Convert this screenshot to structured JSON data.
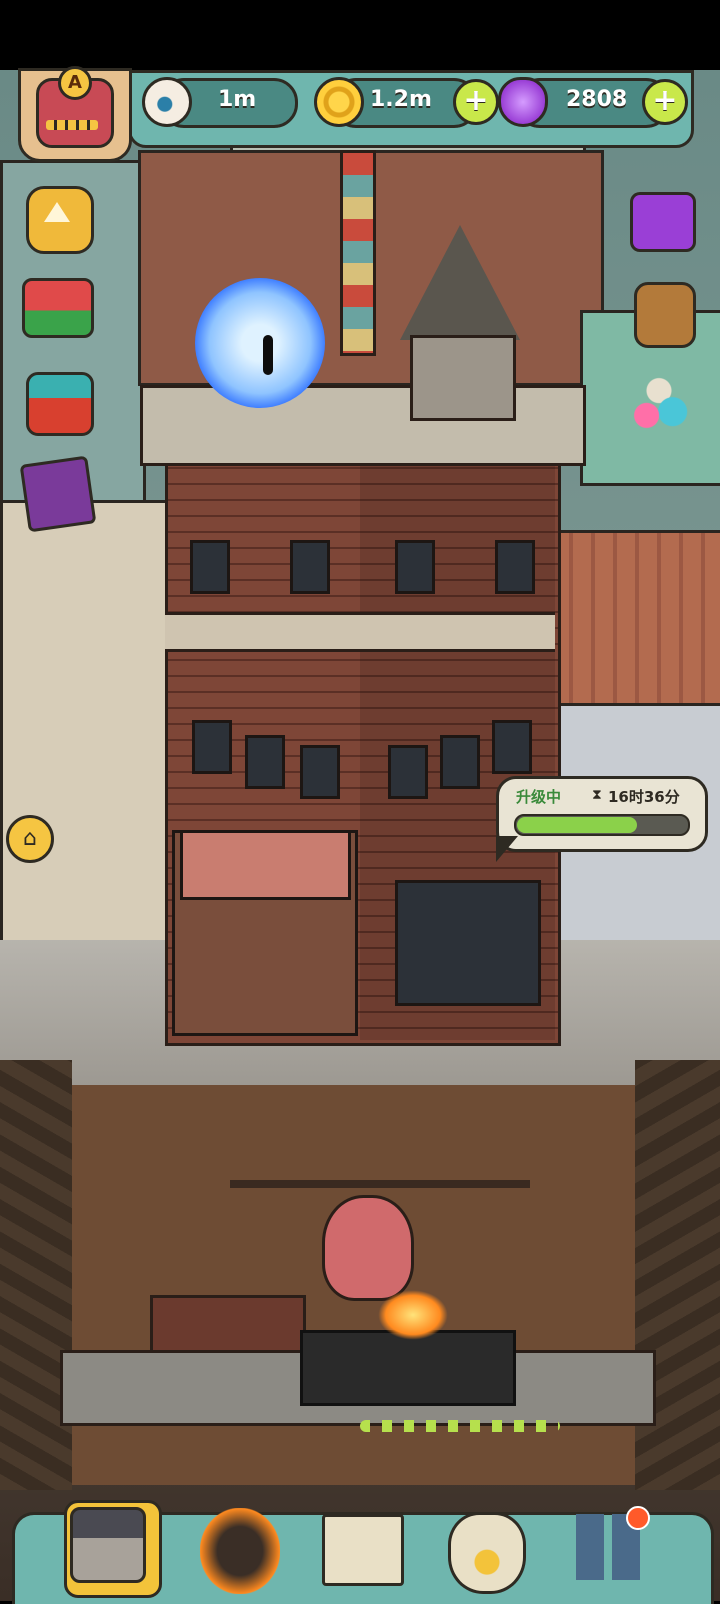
{
  "hud": {
    "level_letter": "A",
    "eyes_value": "1m",
    "coins_value": "1.2m",
    "potions_value": "2808",
    "plus_symbol": "+",
    "colors": {
      "bar": "#6fb6ae",
      "plus": "#c9e84a",
      "coin": "#ffd54a",
      "potion": "#9a3fd6"
    }
  },
  "left_buttons": [
    "up-arrow-icon",
    "gift-box-icon",
    "fruit-crate-icon",
    "card-pack-icon"
  ],
  "right_buttons": [
    "video-tv-icon",
    "backpack-icon",
    "eggs-icon"
  ],
  "home_icon": "⌂",
  "upgrade": {
    "label": "升级中",
    "hourglass": "⧗",
    "time_left": "16时36分",
    "progress": 0.72
  },
  "bottom_nav": {
    "items": [
      "building-icon",
      "monster-icon",
      "book-icon",
      "coin-bag-icon",
      "grid-icon"
    ],
    "active_index": 0,
    "notification": true
  }
}
